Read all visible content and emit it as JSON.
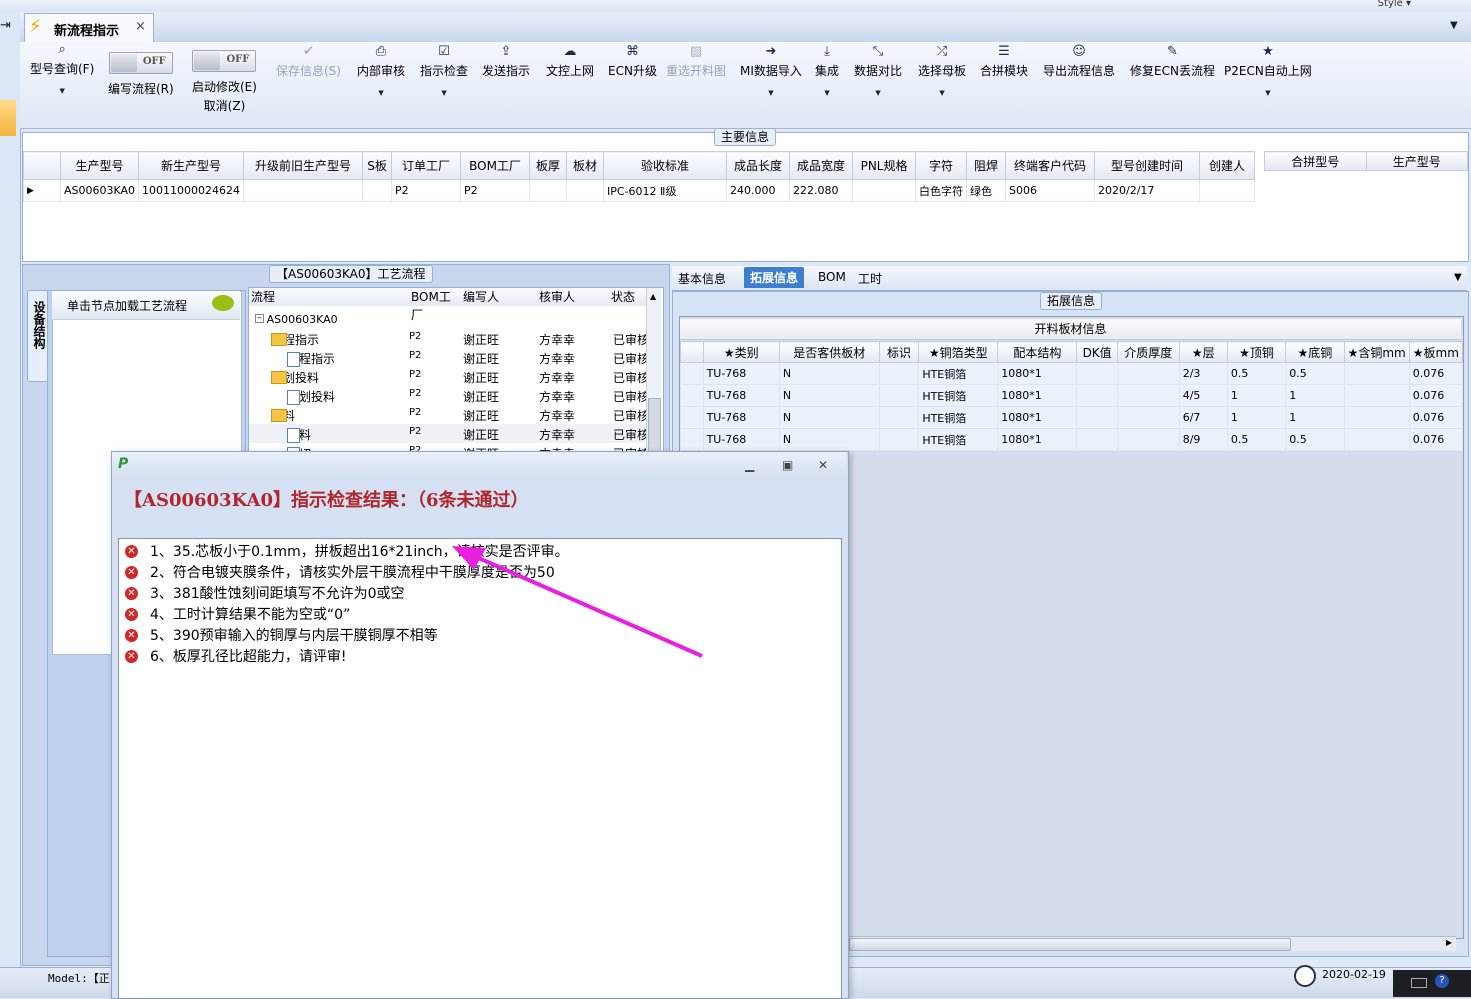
{
  "app": {
    "style_label": "Style"
  },
  "tab": {
    "title": "新流程指示",
    "close": "×"
  },
  "toolbar": {
    "items": [
      {
        "label": "型号查询(F)",
        "icon": "search-icon"
      },
      {
        "label": "编写流程(R)",
        "toggle": "OFF"
      },
      {
        "label": "启动修改(E)",
        "sub": "取消(Z)",
        "toggle": "OFF"
      },
      {
        "label": "保存信息(S)",
        "icon": "check-icon",
        "disabled": true
      },
      {
        "label": "内部审核",
        "icon": "print-icon"
      },
      {
        "label": "指示检查",
        "icon": "checkbox-icon"
      },
      {
        "label": "发送指示",
        "icon": "upload-icon"
      },
      {
        "label": "文控上网",
        "icon": "cloud-upload-icon"
      },
      {
        "label": "ECN升级",
        "icon": "binoculars-icon"
      },
      {
        "label": "重选开料图",
        "icon": "image-icon",
        "disabled": true
      },
      {
        "label": "MI数据导入",
        "icon": "sign-in-icon"
      },
      {
        "label": "集成",
        "icon": "download-icon"
      },
      {
        "label": "数据对比",
        "icon": "compress-icon"
      },
      {
        "label": "选择母板",
        "icon": "shuffle-icon"
      },
      {
        "label": "合拼模块",
        "icon": "list-icon"
      },
      {
        "label": "导出流程信息",
        "icon": "smile-icon"
      },
      {
        "label": "修复ECN丢流程",
        "icon": "wrench-icon"
      },
      {
        "label": "P2ECN自动上网",
        "icon": "star-icon"
      }
    ]
  },
  "main_info": {
    "caption": "主要信息",
    "columns": [
      "生产型号",
      "新生产型号",
      "升级前旧生产型号",
      "S板",
      "订单工厂",
      "BOM工厂",
      "板厚",
      "板材",
      "验收标准",
      "成品长度",
      "成品宽度",
      "PNL规格",
      "字符",
      "阻焊",
      "终端客户代码",
      "型号创建时间",
      "创建人"
    ],
    "row": [
      "AS00603KA0",
      "10011000024624",
      "",
      "",
      "P2",
      "P2",
      "",
      "",
      "IPC-6012 Ⅱ级",
      "240.000",
      "222.080",
      "",
      "白色字符",
      "绿色",
      "S006",
      "2020/2/17",
      ""
    ],
    "side_columns": [
      "合拼型号",
      "生产型号"
    ]
  },
  "process": {
    "caption": "【AS00603KA0】工艺流程",
    "side_tab": "设备结构",
    "node_hint": "单击节点加载工艺流程",
    "columns": [
      "流程",
      "BOM工厂",
      "编写人",
      "核审人",
      "状态"
    ],
    "rows": [
      {
        "name": "AS00603KA0",
        "level": 0,
        "kind": "root",
        "bom": "",
        "writer": "",
        "reviewer": "",
        "status": ""
      },
      {
        "name": "流程指示",
        "level": 1,
        "kind": "folder",
        "bom": "P2",
        "writer": "谢正旺",
        "reviewer": "方幸幸",
        "status": "已审核"
      },
      {
        "name": "流程指示",
        "level": 2,
        "kind": "page",
        "bom": "P2",
        "writer": "谢正旺",
        "reviewer": "方幸幸",
        "status": "已审核"
      },
      {
        "name": "计划投料",
        "level": 1,
        "kind": "folder",
        "bom": "P2",
        "writer": "谢正旺",
        "reviewer": "方幸幸",
        "status": "已审核"
      },
      {
        "name": "计划投料",
        "level": 2,
        "kind": "page",
        "bom": "P2",
        "writer": "谢正旺",
        "reviewer": "方幸幸",
        "status": "已审核"
      },
      {
        "name": "开料",
        "level": 1,
        "kind": "folder",
        "bom": "P2",
        "writer": "谢正旺",
        "reviewer": "方幸幸",
        "status": "已审核"
      },
      {
        "name": "开料",
        "level": 2,
        "kind": "page",
        "bom": "P2",
        "writer": "谢正旺",
        "reviewer": "方幸幸",
        "status": "已审核",
        "selected": true
      },
      {
        "name": "裁切",
        "level": 2,
        "kind": "page",
        "bom": "P2",
        "writer": "谢正旺",
        "reviewer": "方幸幸",
        "status": "已审核"
      }
    ]
  },
  "right_tabs": [
    "基本信息",
    "拓展信息",
    "BOM",
    "工时"
  ],
  "ext_info": {
    "caption": "拓展信息",
    "grid_title": "开料板材信息",
    "columns": [
      "★类别",
      "是否客供板材",
      "标识",
      "★铜箔类型",
      "配本结构",
      "DK值",
      "介质厚度",
      "★层",
      "★顶铜",
      "★底铜",
      "★含铜mm",
      "★板mm"
    ],
    "rows": [
      [
        "TU-768",
        "N",
        "",
        "HTE铜箔",
        "1080*1",
        "",
        "",
        "2/3",
        "0.5",
        "0.5",
        "",
        "0.076"
      ],
      [
        "TU-768",
        "N",
        "",
        "HTE铜箔",
        "1080*1",
        "",
        "",
        "4/5",
        "1",
        "1",
        "",
        "0.076"
      ],
      [
        "TU-768",
        "N",
        "",
        "HTE铜箔",
        "1080*1",
        "",
        "",
        "6/7",
        "1",
        "1",
        "",
        "0.076"
      ],
      [
        "TU-768",
        "N",
        "",
        "HTE铜箔",
        "1080*1",
        "",
        "",
        "8/9",
        "0.5",
        "0.5",
        "",
        "0.076"
      ]
    ]
  },
  "dialog": {
    "logo": "P",
    "heading": "【AS00603KA0】指示检查结果：（6条未通过）",
    "items": [
      "1、35.芯板小于0.1mm，拼板超出16*21inch，请核实是否评审。",
      "2、符合电镀夹膜条件，请核实外层干膜流程中干膜厚度是否为50",
      "3、381酸性蚀刻间距填写不允许为0或空",
      "4、工时计算结果不能为空或“0”",
      "5、390预审输入的铜厚与内层干膜铜厚不相等",
      "6、板厚孔径比超能力，请评审!"
    ]
  },
  "status_bar": {
    "model": "Model:【正",
    "date": "2020-02-19"
  },
  "colors": {
    "accent": "#3c7fd1",
    "error": "#d32727",
    "heading": "#b0262a",
    "arrow": "#e81ee0"
  }
}
